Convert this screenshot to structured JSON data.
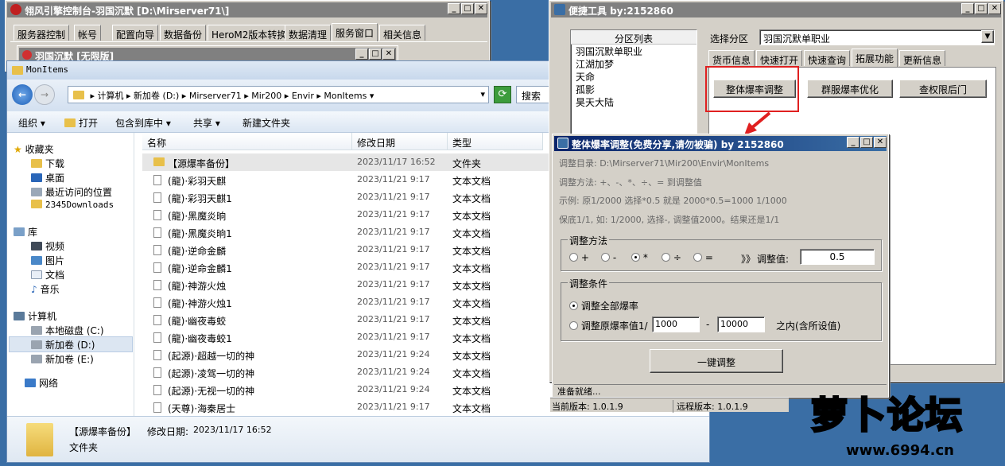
{
  "console": {
    "title": "翎风引擎控制台-羽国沉默 [D:\\Mirserver71\\]",
    "tabs": [
      "服务器控制",
      "帐号",
      "配置向导",
      "数据备份",
      "HeroM2版本转换",
      "数据清理",
      "服务窗口",
      "相关信息"
    ],
    "inner_title": "羽国沉默 [无限版]"
  },
  "explorer": {
    "title": "MonItems",
    "breadcrumb": [
      "计算机",
      "新加卷 (D:)",
      "Mirserver71",
      "Mir200",
      "Envir",
      "MonItems"
    ],
    "search_placeholder": "搜索",
    "toolbar": [
      "组织",
      "打开",
      "包含到库中",
      "共享",
      "新建文件夹"
    ],
    "nav": {
      "favorites": "收藏夹",
      "fav_items": [
        "下载",
        "桌面",
        "最近访问的位置",
        "2345Downloads"
      ],
      "libraries": "库",
      "lib_items": [
        "视频",
        "图片",
        "文档",
        "音乐"
      ],
      "computer": "计算机",
      "drives": [
        "本地磁盘 (C:)",
        "新加卷 (D:)",
        "新加卷 (E:)"
      ],
      "network": "网络"
    },
    "columns": [
      "名称",
      "修改日期",
      "类型"
    ],
    "files": [
      {
        "name": "【源爆率备份】",
        "date": "2023/11/17 16:52",
        "type": "文件夹"
      },
      {
        "name": "(龍)·彩羽天麒",
        "date": "2023/11/21 9:17",
        "type": "文本文档"
      },
      {
        "name": "(龍)·彩羽天麒1",
        "date": "2023/11/21 9:17",
        "type": "文本文档"
      },
      {
        "name": "(龍)·黑魔炎晌",
        "date": "2023/11/21 9:17",
        "type": "文本文档"
      },
      {
        "name": "(龍)·黑魔炎晌1",
        "date": "2023/11/21 9:17",
        "type": "文本文档"
      },
      {
        "name": "(龍)·逆命金麟",
        "date": "2023/11/21 9:17",
        "type": "文本文档"
      },
      {
        "name": "(龍)·逆命金麟1",
        "date": "2023/11/21 9:17",
        "type": "文本文档"
      },
      {
        "name": "(龍)·神游火烛",
        "date": "2023/11/21 9:17",
        "type": "文本文档"
      },
      {
        "name": "(龍)·神游火烛1",
        "date": "2023/11/21 9:17",
        "type": "文本文档"
      },
      {
        "name": "(龍)·幽夜毒蛟",
        "date": "2023/11/21 9:17",
        "type": "文本文档"
      },
      {
        "name": "(龍)·幽夜毒蛟1",
        "date": "2023/11/21 9:17",
        "type": "文本文档"
      },
      {
        "name": "(起源)·超越一切的神",
        "date": "2023/11/21 9:24",
        "type": "文本文档"
      },
      {
        "name": "(起源)·凌驾一切的神",
        "date": "2023/11/21 9:24",
        "type": "文本文档"
      },
      {
        "name": "(起源)·无视一切的神",
        "date": "2023/11/21 9:24",
        "type": "文本文档"
      },
      {
        "name": "(天尊)·海秦居士",
        "date": "2023/11/21 9:17",
        "type": "文本文档"
      }
    ],
    "details": {
      "name": "【源爆率备份】",
      "date_label": "修改日期:",
      "date": "2023/11/17 16:52",
      "type": "文件夹"
    }
  },
  "tool": {
    "title": "便捷工具  by:2152860",
    "list_header": "分区列表",
    "partitions": [
      "羽国沉默单职业",
      "江湖加梦",
      "天命",
      "孤影",
      "昊天大陆"
    ],
    "select_label": "选择分区",
    "select_value": "羽国沉默单职业",
    "tabs": [
      "货币信息",
      "快速打开",
      "快速查询",
      "拓展功能",
      "更新信息"
    ],
    "buttons": [
      "整体爆率调整",
      "群服爆率优化",
      "查权限后门"
    ]
  },
  "adjust": {
    "title": "整体爆率调整(免费分享,请勿被骗)   by 2152860",
    "dir": "调整目录: D:\\Mirserver71\\Mir200\\Envir\\MonItems",
    "method_line": "调整方法: +、-、*、÷、=  到调整值",
    "example": "示例: 原1/2000 选择*0.5 就是 2000*0.5=1000  1/1000",
    "note": "保底1/1, 如: 1/2000, 选择-, 调整值2000。结果还是1/1",
    "method_group": "调整方法",
    "ops": [
      "+",
      "-",
      "*",
      "÷",
      "="
    ],
    "selected_op": 2,
    "arrow": "》》",
    "value_label": "调整值:",
    "value": "0.5",
    "cond_group": "调整条件",
    "cond_all": "调整全部爆率",
    "cond_range": "调整原爆率值1/",
    "range_from": "1000",
    "range_dash": "-",
    "range_to": "10000",
    "range_suffix": "之内(含所设值)",
    "run_button": "一键调整",
    "status": "准备就绪..."
  },
  "footer": {
    "current": "当前版本: 1.0.1.9",
    "remote": "远程版本: 1.0.1.9"
  },
  "watermark": {
    "text": "萝卜论坛",
    "url": "www.6994.cn"
  }
}
